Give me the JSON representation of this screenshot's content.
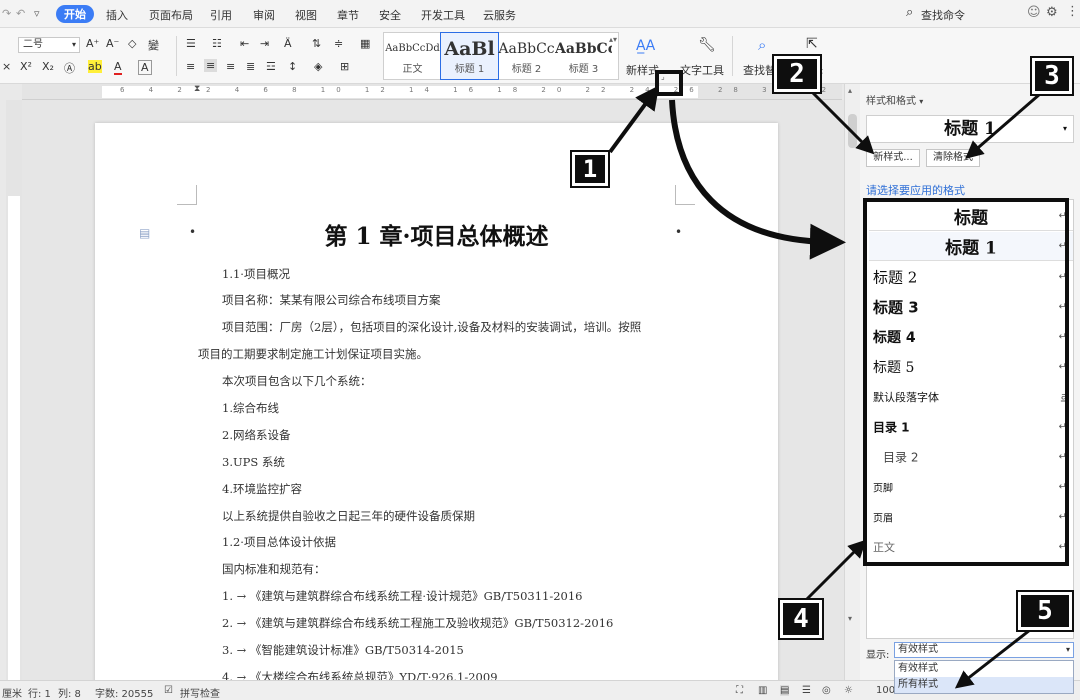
{
  "menubar": {
    "tabs": [
      "开始",
      "插入",
      "页面布局",
      "引用",
      "审阅",
      "视图",
      "章节",
      "安全",
      "开发工具",
      "云服务"
    ],
    "active_tab": "开始",
    "search_label": "查找命令"
  },
  "ribbon": {
    "font_size": "二号",
    "styles": [
      {
        "sample": "AaBbCcDd",
        "label": "正文"
      },
      {
        "sample": "AaBl",
        "label": "标题 1"
      },
      {
        "sample": "AaBbCc",
        "label": "标题 2"
      },
      {
        "sample": "AaBbCc",
        "label": "标题 3"
      }
    ],
    "new_style_label": "新样式",
    "text_tools_label": "文字工具",
    "find_replace_label": "查找替",
    "select_label": "择"
  },
  "ruler_numbers": [
    "6",
    "4",
    "2",
    "2",
    "4",
    "6",
    "8",
    "10",
    "12",
    "14",
    "16",
    "18",
    "20",
    "22",
    "24",
    "26",
    "28",
    "30",
    "32",
    "34",
    "36",
    "38",
    "42",
    "44",
    "46"
  ],
  "document": {
    "title": "第 1 章·项目总体概述",
    "lines": [
      "1.1·项目概况",
      "项目名称：某某有限公司综合布线项目方案",
      "项目范围：厂房（2层），包括项目的深化设计,设备及材料的安装调试，培训。按照",
      "项目的工期要求制定施工计划保证项目实施。",
      "本次项目包含以下几个系统：",
      "1.综合布线",
      "2.网络系设备",
      "3.UPS 系统",
      "4.环境监控扩容",
      "以上系统提供自验收之日起三年的硬件设备质保期",
      "1.2·项目总体设计依据",
      "国内标准和规范有：",
      "1. → 《建筑与建筑群综合布线系统工程·设计规范》GB/T50311-2016",
      "2. → 《建筑与建筑群综合布线系统工程施工及验收规范》GB/T50312-2016",
      "3. → 《智能建筑设计标准》GB/T50314-2015",
      "4. → 《大楼综合布线系统总规范》YD/T·926.1-2009"
    ]
  },
  "panel": {
    "header": "样式和格式",
    "current_style": "标题 1",
    "new_style_button": "新样式...",
    "clear_format_button": "清除格式",
    "apply_label": "请选择要应用的格式",
    "styles": [
      {
        "label": "标题",
        "mark": "↵"
      },
      {
        "label": "标题 1",
        "mark": "↵"
      },
      {
        "label": "标题 2",
        "mark": "↵"
      },
      {
        "label": "标题 3",
        "mark": "↵"
      },
      {
        "label": "标题 4",
        "mark": "↵"
      },
      {
        "label": "标题 5",
        "mark": "↵"
      },
      {
        "label": "默认段落字体",
        "mark": "a"
      },
      {
        "label": "目录 1",
        "mark": "↵"
      },
      {
        "label": "目录 2",
        "mark": "↵"
      },
      {
        "label": "页脚",
        "mark": "↵"
      },
      {
        "label": "页眉",
        "mark": "↵"
      },
      {
        "label": "正文",
        "mark": "↵"
      }
    ],
    "show_label": "显示:",
    "show_value": "有效样式",
    "show_options": [
      "有效样式",
      "所有样式"
    ]
  },
  "statusbar": {
    "unit": "厘米",
    "row": "行: 1",
    "col": "列: 8",
    "word_count": "字数: 20555",
    "spell_check": "拼写检查",
    "zoom": "100"
  },
  "callouts": [
    "1",
    "2",
    "3",
    "4",
    "5"
  ],
  "colors": {
    "accent": "#3b7cf5",
    "link": "#2f6fd6",
    "annotation": "#0e0e0e"
  }
}
